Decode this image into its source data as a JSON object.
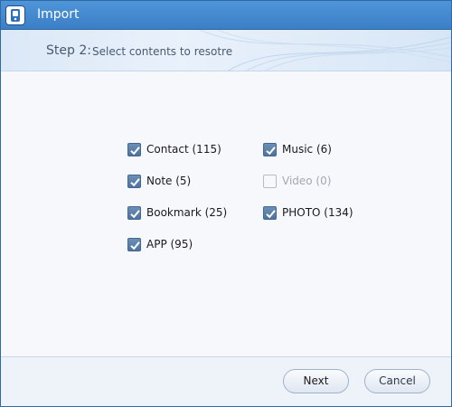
{
  "window": {
    "title": "Import"
  },
  "header": {
    "step_label": "Step 2:",
    "step_description": "Select contents to resotre"
  },
  "items": [
    {
      "label": "Contact (115)",
      "checked": true,
      "enabled": true
    },
    {
      "label": "Note (5)",
      "checked": true,
      "enabled": true
    },
    {
      "label": "Bookmark (25)",
      "checked": true,
      "enabled": true
    },
    {
      "label": "APP (95)",
      "checked": true,
      "enabled": true
    },
    {
      "label": "Music (6)",
      "checked": true,
      "enabled": true
    },
    {
      "label": "Video (0)",
      "checked": false,
      "enabled": false
    },
    {
      "label": "PHOTO (134)",
      "checked": true,
      "enabled": true
    }
  ],
  "footer": {
    "next_label": "Next",
    "cancel_label": "Cancel"
  },
  "colors": {
    "titlebar": "#3b7fc7",
    "checkbox_checked": "#4d739f",
    "disabled_text": "#a3a8b0"
  }
}
